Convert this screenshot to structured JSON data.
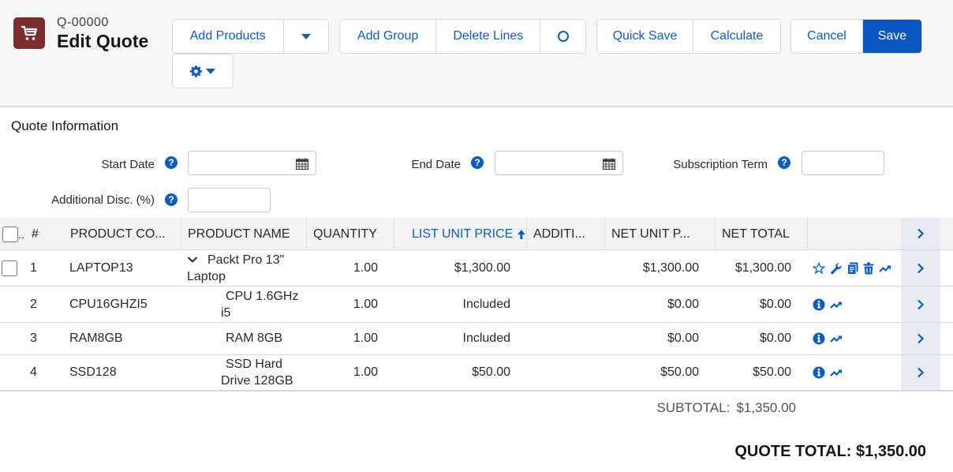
{
  "header": {
    "icon": "cart-icon",
    "record_number": "Q-00000",
    "title": "Edit Quote",
    "brand_color": "#7a2e2e",
    "accent_color": "#0a57c2"
  },
  "toolbar": {
    "add_products": "Add Products",
    "add_products_menu_icon": "caret-down-icon",
    "add_group": "Add Group",
    "delete_lines": "Delete Lines",
    "circle_button_icon": "circle-icon",
    "quick_save": "Quick Save",
    "calculate": "Calculate",
    "cancel": "Cancel",
    "save": "Save",
    "settings_icon": "gear-icon"
  },
  "quote_info": {
    "section_title": "Quote Information",
    "fields": {
      "start_date": {
        "label": "Start Date",
        "value": ""
      },
      "end_date": {
        "label": "End Date",
        "value": ""
      },
      "subscription_term": {
        "label": "Subscription Term",
        "value": ""
      },
      "additional_disc": {
        "label": "Additional Disc. (%)",
        "value": ""
      }
    },
    "help_glyph": "?"
  },
  "table": {
    "columns": [
      {
        "key": "select",
        "label": ".."
      },
      {
        "key": "num",
        "label": "#"
      },
      {
        "key": "product_code",
        "label": "PRODUCT CO..."
      },
      {
        "key": "product_name",
        "label": "PRODUCT NAME"
      },
      {
        "key": "quantity",
        "label": "QUANTITY"
      },
      {
        "key": "list_unit_price",
        "label": "LIST UNIT PRICE",
        "sorted": "ascending"
      },
      {
        "key": "additional",
        "label": "ADDITI..."
      },
      {
        "key": "net_unit_price",
        "label": "NET UNIT P..."
      },
      {
        "key": "net_total",
        "label": "NET TOTAL"
      }
    ],
    "rows": [
      {
        "num": "1",
        "product_code": "LAPTOP13",
        "product_name_line1": "Packt Pro 13\"",
        "product_name_line2": "Laptop",
        "quantity": "1.00",
        "list_unit_price": "$1,300.00",
        "additional": "",
        "net_unit_price": "$1,300.00",
        "net_total": "$1,300.00",
        "actions": [
          "star-icon",
          "wrench-icon",
          "copy-icon",
          "trash-icon",
          "trend-icon"
        ]
      },
      {
        "num": "2",
        "product_code": "CPU16GHZI5",
        "product_name_line1": "CPU 1.6GHz",
        "product_name_line2": "i5",
        "quantity": "1.00",
        "list_unit_price": "Included",
        "additional": "",
        "net_unit_price": "$0.00",
        "net_total": "$0.00",
        "actions": [
          "info-icon",
          "trend-icon"
        ]
      },
      {
        "num": "3",
        "product_code": "RAM8GB",
        "product_name_line1": "RAM 8GB",
        "product_name_line2": "",
        "quantity": "1.00",
        "list_unit_price": "Included",
        "additional": "",
        "net_unit_price": "$0.00",
        "net_total": "$0.00",
        "actions": [
          "info-icon",
          "trend-icon"
        ]
      },
      {
        "num": "4",
        "product_code": "SSD128",
        "product_name_line1": "SSD Hard",
        "product_name_line2": "Drive 128GB",
        "quantity": "1.00",
        "list_unit_price": "$50.00",
        "additional": "",
        "net_unit_price": "$50.00",
        "net_total": "$50.00",
        "actions": [
          "info-icon",
          "trend-icon"
        ]
      }
    ]
  },
  "totals": {
    "subtotal_label": "SUBTOTAL:",
    "subtotal_value": "$1,350.00",
    "quote_total_label": "QUOTE TOTAL:",
    "quote_total_value": "$1,350.00"
  }
}
